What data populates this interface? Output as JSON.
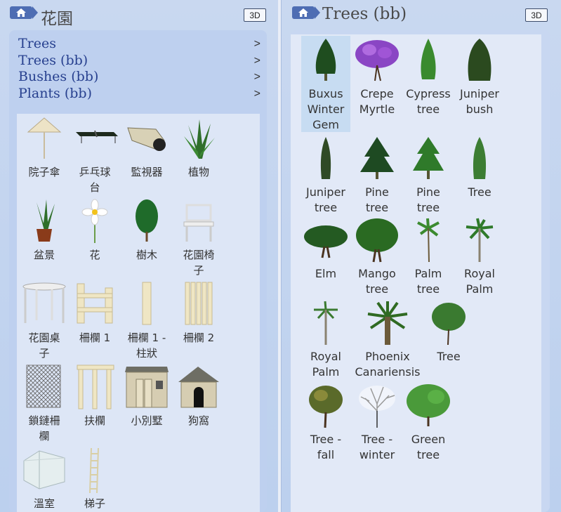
{
  "left": {
    "title": "花園",
    "button_3d": "3D",
    "menu": [
      {
        "label": "Trees",
        "chevron": ">"
      },
      {
        "label": "Trees (bb)",
        "chevron": ">"
      },
      {
        "label": "Bushes (bb)",
        "chevron": ">"
      },
      {
        "label": "Plants (bb)",
        "chevron": ">"
      }
    ],
    "items": [
      {
        "line1": "院子傘",
        "line2": "",
        "icon": "parasol-icon"
      },
      {
        "line1": "乒乓球",
        "line2": "台",
        "icon": "ping-pong-table-icon"
      },
      {
        "line1": "監視器",
        "line2": "",
        "icon": "security-camera-icon"
      },
      {
        "line1": "植物",
        "line2": "",
        "icon": "plant-icon"
      },
      {
        "line1": "盆景",
        "line2": "",
        "icon": "potted-plant-icon"
      },
      {
        "line1": "花",
        "line2": "",
        "icon": "flower-icon"
      },
      {
        "line1": "樹木",
        "line2": "",
        "icon": "tree-icon"
      },
      {
        "line1": "花園椅",
        "line2": "子",
        "icon": "garden-chair-icon"
      },
      {
        "line1": "花園桌",
        "line2": "子",
        "icon": "garden-table-icon"
      },
      {
        "line1": "柵欄 1",
        "line2": "",
        "icon": "fence-icon"
      },
      {
        "line1": "柵欄 1 -",
        "line2": "柱狀",
        "icon": "fence-post-icon"
      },
      {
        "line1": "柵欄 2",
        "line2": "",
        "icon": "fence-2-icon"
      },
      {
        "line1": "鎖鏈柵",
        "line2": "欄",
        "icon": "chain-fence-icon"
      },
      {
        "line1": "扶欄",
        "line2": "",
        "icon": "railing-icon"
      },
      {
        "line1": "小別墅",
        "line2": "",
        "icon": "shed-icon"
      },
      {
        "line1": "狗窩",
        "line2": "",
        "icon": "doghouse-icon"
      },
      {
        "line1": "溫室",
        "line2": "",
        "icon": "greenhouse-icon"
      },
      {
        "line1": "梯子",
        "line2": "",
        "icon": "ladder-icon"
      }
    ]
  },
  "right": {
    "title": "Trees (bb)",
    "button_3d": "3D",
    "items": [
      {
        "lines": [
          "Buxus",
          "Winter",
          "Gem"
        ],
        "icon": "buxus-icon",
        "selected": true
      },
      {
        "lines": [
          "Crepe",
          "Myrtle"
        ],
        "icon": "crepe-myrtle-icon"
      },
      {
        "lines": [
          "Cypress",
          "tree"
        ],
        "icon": "cypress-icon"
      },
      {
        "lines": [
          "Juniper",
          "bush"
        ],
        "icon": "juniper-bush-icon"
      },
      {
        "lines": [
          "Juniper",
          "tree"
        ],
        "icon": "juniper-tree-icon"
      },
      {
        "lines": [
          "Pine",
          "tree"
        ],
        "icon": "pine-tree-icon"
      },
      {
        "lines": [
          "Pine",
          "tree"
        ],
        "icon": "pine-tree-2-icon"
      },
      {
        "lines": [
          "Tree"
        ],
        "icon": "tree-conifer-icon"
      },
      {
        "lines": [
          "Elm"
        ],
        "icon": "elm-icon"
      },
      {
        "lines": [
          "Mango",
          "tree"
        ],
        "icon": "mango-tree-icon"
      },
      {
        "lines": [
          "Palm",
          "tree"
        ],
        "icon": "palm-tree-icon"
      },
      {
        "lines": [
          "Royal",
          "Palm"
        ],
        "icon": "royal-palm-icon"
      },
      {
        "lines": [
          "Royal",
          "Palm"
        ],
        "icon": "royal-palm-2-icon"
      },
      {
        "lines": [
          "Phoenix",
          "Canariensis"
        ],
        "icon": "phoenix-palm-icon"
      },
      {
        "lines": [
          "Tree"
        ],
        "icon": "tree-round-icon"
      },
      {
        "lines": [
          "Tree -",
          "fall"
        ],
        "icon": "tree-fall-icon"
      },
      {
        "lines": [
          "Tree -",
          "winter"
        ],
        "icon": "tree-winter-icon"
      },
      {
        "lines": [
          "Green",
          "tree"
        ],
        "icon": "green-tree-icon"
      }
    ]
  }
}
